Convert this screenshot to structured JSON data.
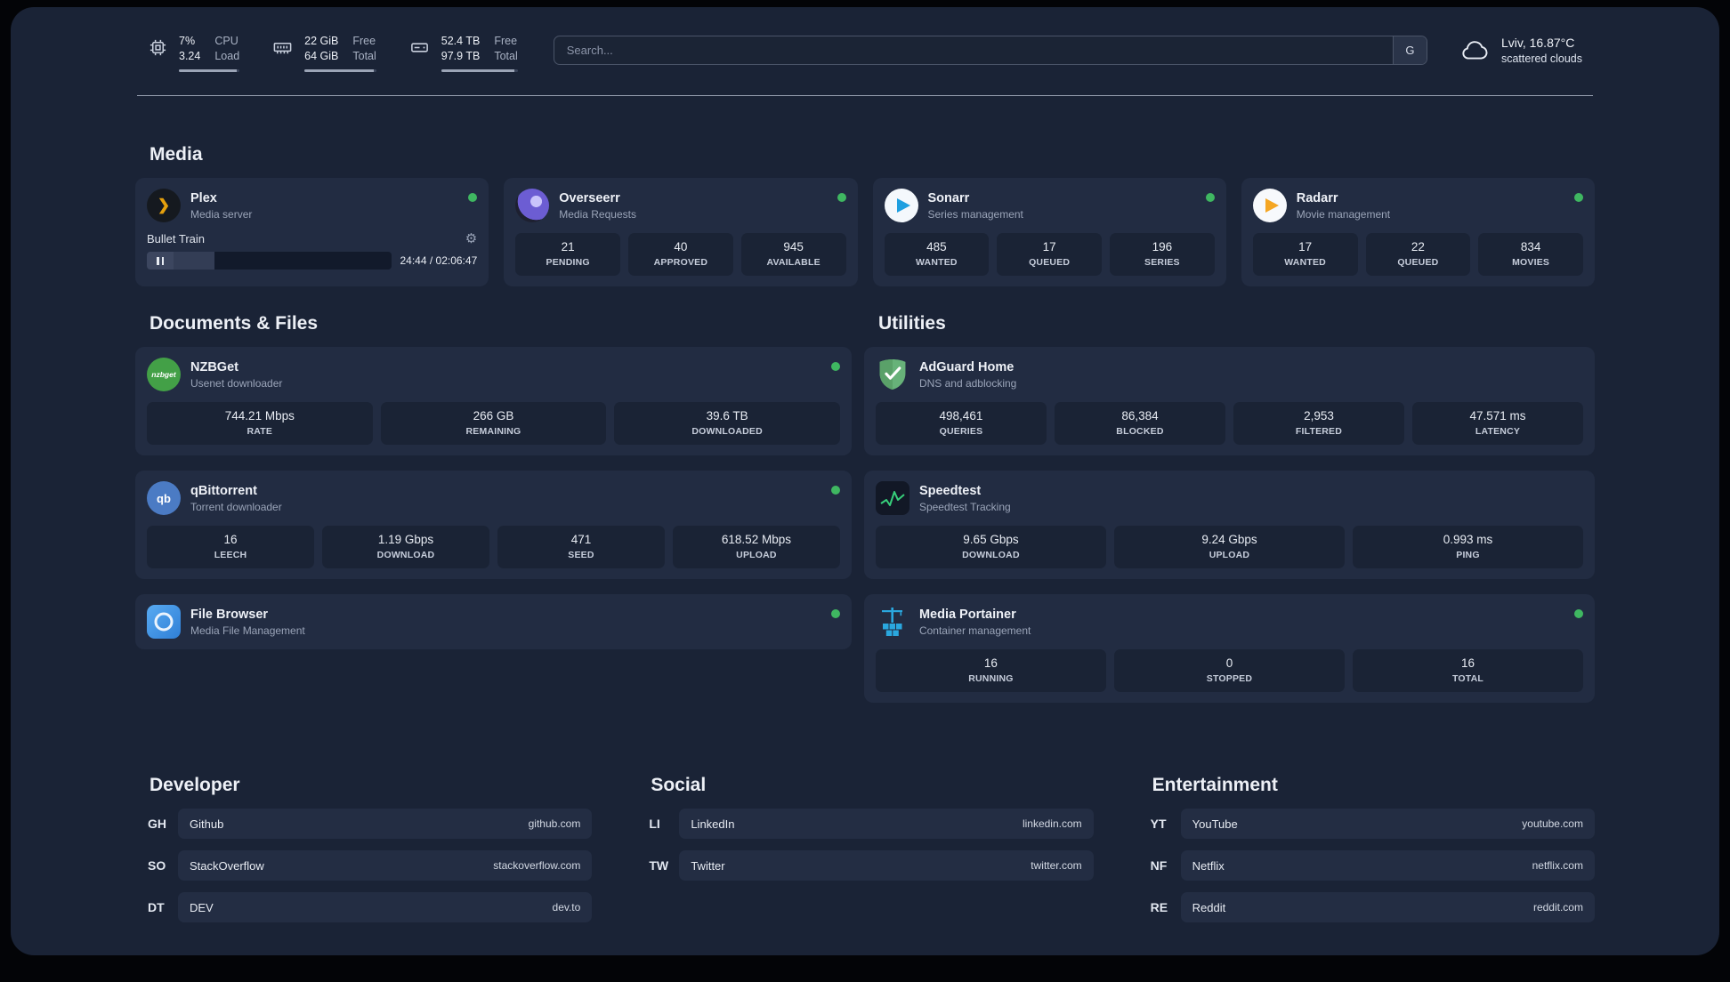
{
  "topbar": {
    "cpu": {
      "value_top": "7%",
      "value_bottom": "3.24",
      "label_top": "CPU",
      "label_bottom": "Load"
    },
    "ram": {
      "value_top": "22 GiB",
      "value_bottom": "64 GiB",
      "label_top": "Free",
      "label_bottom": "Total"
    },
    "disk": {
      "value_top": "52.4 TB",
      "value_bottom": "97.9 TB",
      "label_top": "Free",
      "label_bottom": "Total"
    },
    "search": {
      "placeholder": "Search...",
      "button_label": "G"
    },
    "weather": {
      "location": "Lviv, 16.87°C",
      "condition": "scattered clouds"
    }
  },
  "icons": {
    "settings_glyph": "⚙",
    "plex_glyph": "❯",
    "nzbget_label": "nzbget",
    "qbittorrent_label": "qb"
  },
  "colors": {
    "status_online": "#3fb761",
    "accent_green": "#37d07b",
    "plex_gold": "#e5a00d"
  },
  "sections": {
    "media": {
      "title": "Media",
      "cards": [
        {
          "name": "Plex",
          "description": "Media server",
          "status": "online",
          "player": {
            "title": "Bullet Train",
            "time": "24:44 / 02:06:47"
          }
        },
        {
          "name": "Overseerr",
          "description": "Media Requests",
          "status": "online",
          "stats": [
            {
              "value": "21",
              "label": "PENDING"
            },
            {
              "value": "40",
              "label": "APPROVED"
            },
            {
              "value": "945",
              "label": "AVAILABLE"
            }
          ]
        },
        {
          "name": "Sonarr",
          "description": "Series management",
          "status": "online",
          "stats": [
            {
              "value": "485",
              "label": "WANTED"
            },
            {
              "value": "17",
              "label": "QUEUED"
            },
            {
              "value": "196",
              "label": "SERIES"
            }
          ]
        },
        {
          "name": "Radarr",
          "description": "Movie management",
          "status": "online",
          "stats": [
            {
              "value": "17",
              "label": "WANTED"
            },
            {
              "value": "22",
              "label": "QUEUED"
            },
            {
              "value": "834",
              "label": "MOVIES"
            }
          ]
        }
      ]
    },
    "documents": {
      "title": "Documents & Files",
      "cards": [
        {
          "name": "NZBGet",
          "description": "Usenet downloader",
          "status": "online",
          "stats": [
            {
              "value": "744.21 Mbps",
              "label": "RATE"
            },
            {
              "value": "266 GB",
              "label": "REMAINING"
            },
            {
              "value": "39.6 TB",
              "label": "DOWNLOADED"
            }
          ]
        },
        {
          "name": "qBittorrent",
          "description": "Torrent downloader",
          "status": "online",
          "stats": [
            {
              "value": "16",
              "label": "LEECH"
            },
            {
              "value": "1.19 Gbps",
              "label": "DOWNLOAD"
            },
            {
              "value": "471",
              "label": "SEED"
            },
            {
              "value": "618.52 Mbps",
              "label": "UPLOAD"
            }
          ]
        },
        {
          "name": "File Browser",
          "description": "Media File Management",
          "status": "online"
        }
      ]
    },
    "utilities": {
      "title": "Utilities",
      "cards": [
        {
          "name": "AdGuard Home",
          "description": "DNS and adblocking",
          "stats": [
            {
              "value": "498,461",
              "label": "QUERIES"
            },
            {
              "value": "86,384",
              "label": "BLOCKED"
            },
            {
              "value": "2,953",
              "label": "FILTERED"
            },
            {
              "value": "47.571 ms",
              "label": "LATENCY"
            }
          ]
        },
        {
          "name": "Speedtest",
          "description": "Speedtest Tracking",
          "stats": [
            {
              "value": "9.65 Gbps",
              "label": "DOWNLOAD"
            },
            {
              "value": "9.24 Gbps",
              "label": "UPLOAD"
            },
            {
              "value": "0.993 ms",
              "label": "PING"
            }
          ]
        },
        {
          "name": "Media Portainer",
          "description": "Container management",
          "status": "online",
          "stats": [
            {
              "value": "16",
              "label": "RUNNING"
            },
            {
              "value": "0",
              "label": "STOPPED"
            },
            {
              "value": "16",
              "label": "TOTAL"
            }
          ]
        }
      ]
    }
  },
  "bookmarks": [
    {
      "title": "Developer",
      "items": [
        {
          "abbr": "GH",
          "name": "Github",
          "url": "github.com"
        },
        {
          "abbr": "SO",
          "name": "StackOverflow",
          "url": "stackoverflow.com"
        },
        {
          "abbr": "DT",
          "name": "DEV",
          "url": "dev.to"
        }
      ]
    },
    {
      "title": "Social",
      "items": [
        {
          "abbr": "LI",
          "name": "LinkedIn",
          "url": "linkedin.com"
        },
        {
          "abbr": "TW",
          "name": "Twitter",
          "url": "twitter.com"
        }
      ]
    },
    {
      "title": "Entertainment",
      "items": [
        {
          "abbr": "YT",
          "name": "YouTube",
          "url": "youtube.com"
        },
        {
          "abbr": "NF",
          "name": "Netflix",
          "url": "netflix.com"
        },
        {
          "abbr": "RE",
          "name": "Reddit",
          "url": "reddit.com"
        }
      ]
    }
  ]
}
